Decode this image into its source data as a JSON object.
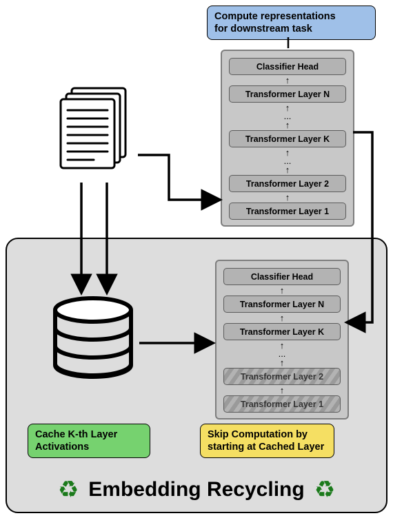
{
  "labels": {
    "compute": "Compute representations\nfor downstream task",
    "cache": "Cache K-th Layer\nActivations",
    "skip": "Skip Computation by\nstarting at Cached Layer"
  },
  "stack_layers": {
    "l1": "Transformer Layer 1",
    "l2": "Transformer Layer 2",
    "lk": "Transformer Layer K",
    "ln": "Transformer Layer N",
    "head": "Classifier Head",
    "ell": "...",
    "arrow": "↑"
  },
  "footer": "Embedding Recycling",
  "icons": {
    "recycle": "♻"
  }
}
